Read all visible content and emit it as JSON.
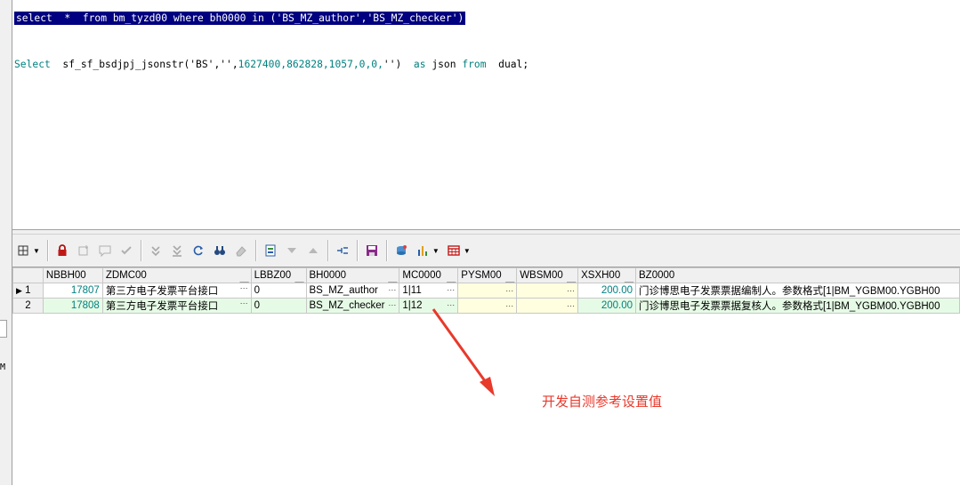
{
  "sql": {
    "line1": "select  *  from bm_tyzd00 where bh0000 in ('BS_MZ_author','BS_MZ_checker')",
    "line2_kw1": "Select",
    "line2_fn": "  sf_sf_bsdjpj_jsonstr('BS','',",
    "line2_nums": "1627400,862828,1057,0,0,",
    "line2_tail": "'')",
    "line2_as": "as",
    "line2_json": " json ",
    "line2_from": "from",
    "line2_dual": "  dual;"
  },
  "gutter": {
    "scrap_char": "M"
  },
  "grid": {
    "columns": [
      "NBBH00",
      "ZDMC00",
      "LBBZ00",
      "BH0000",
      "MC0000",
      "PYSM00",
      "WBSM00",
      "XSXH00",
      "BZ0000"
    ],
    "rows": [
      {
        "idx": "1",
        "marker": "▶",
        "NBBH00": "17807",
        "ZDMC00": "第三方电子发票平台接口",
        "LBBZ00": "0",
        "BH0000": "BS_MZ_author",
        "MC0000": "1|11",
        "PYSM00": "",
        "WBSM00": "",
        "XSXH00": "200.00",
        "BZ0000": "门诊博思电子发票票据编制人。参数格式[1|BM_YGBM00.YGBH00"
      },
      {
        "idx": "2",
        "marker": "",
        "NBBH00": "17808",
        "ZDMC00": "第三方电子发票平台接口",
        "LBBZ00": "0",
        "BH0000": "BS_MZ_checker",
        "MC0000": "1|12",
        "PYSM00": "",
        "WBSM00": "",
        "XSXH00": "200.00",
        "BZ0000": "门诊博思电子发票票据复核人。参数格式[1|BM_YGBM00.YGBH00"
      }
    ]
  },
  "annotation": {
    "text": "开发自测参考设置值",
    "color": "#e8392b"
  },
  "colors": {
    "selection": "#000080",
    "keyword": "#008080",
    "row_alt": "#e6fbe6",
    "cell_yellow": "#ffffe0"
  },
  "icons": [
    "grid-options-icon",
    "lock-icon",
    "insert-record-icon",
    "edit-comment-icon",
    "post-check-icon",
    "move-down-icon",
    "move-last-icon",
    "refresh-icon",
    "find-icon",
    "clear-icon",
    "export-icon",
    "filter-down-icon",
    "filter-up-icon",
    "connect-icon",
    "save-icon",
    "query-icon",
    "chart-icon",
    "table-icon"
  ]
}
